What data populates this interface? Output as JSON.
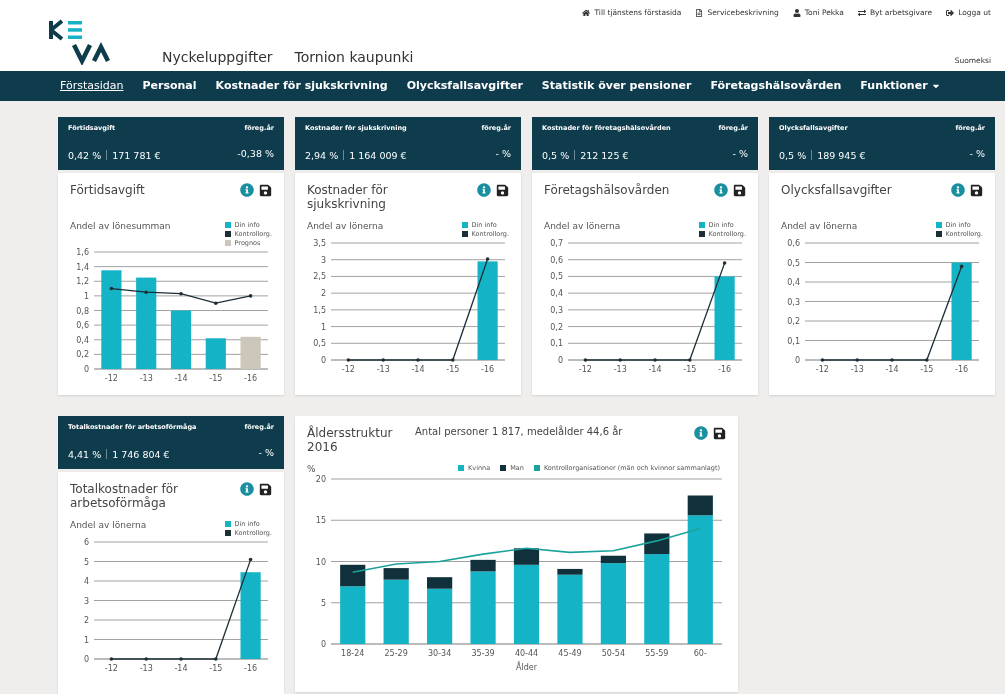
{
  "header": {
    "links": [
      {
        "label": "Till tjänstens förstasida"
      },
      {
        "label": "Servicebeskrivning"
      },
      {
        "label": "Toni Pekka"
      },
      {
        "label": "Byt arbetsgivare"
      },
      {
        "label": "Logga ut"
      }
    ],
    "app_title": "Nyckeluppgifter",
    "organization": "Tornion kaupunki",
    "language": "Suomeksi"
  },
  "nav": [
    {
      "label": "Förstasidan",
      "selected": true,
      "kind": "link"
    },
    {
      "label": "Personal",
      "selected": false,
      "kind": "link"
    },
    {
      "label": "Kostnader för sjukskrivning",
      "selected": false,
      "kind": "link"
    },
    {
      "label": "Olycksfallsavgifter",
      "selected": false,
      "kind": "link"
    },
    {
      "label": "Statistik över pensioner",
      "selected": false,
      "kind": "link"
    },
    {
      "label": "Företagshälsovården",
      "selected": false,
      "kind": "link"
    },
    {
      "label": "Funktioner",
      "selected": false,
      "kind": "dropdown"
    }
  ],
  "widgets": [
    {
      "kind": "small",
      "stat": {
        "title": "Förtidsavgift",
        "prev_label": "föreg.år",
        "percent": "0,42 %",
        "amount": "171 781 €",
        "prev_value": "-0,38 %"
      },
      "card": {
        "title": "Förtidsavgift",
        "chart_data": {
          "type": "bar",
          "grid": true,
          "ylabel": "Andel av lönesumman",
          "categories": [
            "-12",
            "-13",
            "-14",
            "-15",
            "-16"
          ],
          "ylim": [
            0,
            1.6
          ],
          "yticks": [
            {
              "value": 0,
              "label": "0"
            },
            {
              "value": 0.2,
              "label": "0,2"
            },
            {
              "value": 0.4,
              "label": "0,4"
            },
            {
              "value": 0.6,
              "label": "0,6"
            },
            {
              "value": 0.8,
              "label": "0,8"
            },
            {
              "value": 1,
              "label": "1"
            },
            {
              "value": 1.2,
              "label": "1,2"
            },
            {
              "value": 1.4,
              "label": "1,4"
            },
            {
              "value": 1.6,
              "label": "1,6"
            }
          ],
          "series": [
            {
              "name": "Din info",
              "color": "#14b4c6",
              "type": "bar",
              "values": [
                1.35,
                1.25,
                0.8,
                0.42,
                null
              ]
            },
            {
              "name": "Kontrollorg.",
              "color": "#1c2e36",
              "type": "line",
              "values": [
                1.1,
                1.05,
                1.03,
                0.9,
                1.0
              ]
            },
            {
              "name": "Prognos",
              "color": "#cdc6ba",
              "type": "bar",
              "values": [
                null,
                null,
                null,
                null,
                0.44
              ]
            }
          ]
        }
      }
    },
    {
      "kind": "small",
      "stat": {
        "title": "Kostnader för sjukskrivning",
        "prev_label": "föreg.år",
        "percent": "2,94 %",
        "amount": "1 164 009 €",
        "prev_value": "- %"
      },
      "card": {
        "title": "Kostnader för sjukskrivning",
        "chart_data": {
          "type": "bar",
          "grid": true,
          "ylabel": "Andel av lönerna",
          "categories": [
            "-12",
            "-13",
            "-14",
            "-15",
            "-16"
          ],
          "ylim": [
            0,
            3.5
          ],
          "yticks": [
            {
              "value": 0,
              "label": "0"
            },
            {
              "value": 0.5,
              "label": "0,5"
            },
            {
              "value": 1,
              "label": "1"
            },
            {
              "value": 1.5,
              "label": "1,5"
            },
            {
              "value": 2,
              "label": "2"
            },
            {
              "value": 2.5,
              "label": "2,5"
            },
            {
              "value": 3,
              "label": "3"
            },
            {
              "value": 3.5,
              "label": "3,5"
            }
          ],
          "series": [
            {
              "name": "Din info",
              "color": "#14b4c6",
              "type": "bar",
              "values": [
                null,
                null,
                null,
                null,
                2.95
              ]
            },
            {
              "name": "Kontrollorg.",
              "color": "#1c2e36",
              "type": "line",
              "values": [
                0,
                0,
                0,
                0,
                3.02
              ]
            }
          ]
        }
      }
    },
    {
      "kind": "small",
      "stat": {
        "title": "Kostnader för företagshälsovården",
        "prev_label": "föreg.år",
        "percent": "0,5 %",
        "amount": "212 125 €",
        "prev_value": "- %"
      },
      "card": {
        "title": "Företagshälsovården",
        "chart_data": {
          "type": "bar",
          "grid": true,
          "ylabel": "Andel av lönerna",
          "categories": [
            "-12",
            "-13",
            "-14",
            "-15",
            "-16"
          ],
          "ylim": [
            0,
            0.7
          ],
          "yticks": [
            {
              "value": 0,
              "label": "0"
            },
            {
              "value": 0.1,
              "label": "0,1"
            },
            {
              "value": 0.2,
              "label": "0,2"
            },
            {
              "value": 0.3,
              "label": "0,3"
            },
            {
              "value": 0.4,
              "label": "0,4"
            },
            {
              "value": 0.5,
              "label": "0,5"
            },
            {
              "value": 0.6,
              "label": "0,6"
            },
            {
              "value": 0.7,
              "label": "0,7"
            }
          ],
          "series": [
            {
              "name": "Din info",
              "color": "#14b4c6",
              "type": "bar",
              "values": [
                null,
                null,
                null,
                null,
                0.5
              ]
            },
            {
              "name": "Kontrollorg.",
              "color": "#1c2e36",
              "type": "line",
              "values": [
                0,
                0,
                0,
                0,
                0.58
              ]
            }
          ]
        }
      }
    },
    {
      "kind": "small",
      "stat": {
        "title": "Olycksfallsavgifter",
        "prev_label": "föreg.år",
        "percent": "0,5 %",
        "amount": "189 945 €",
        "prev_value": "- %"
      },
      "card": {
        "title": "Olycksfallsavgifter",
        "chart_data": {
          "type": "bar",
          "grid": true,
          "ylabel": "Andel av lönerna",
          "categories": [
            "-12",
            "-13",
            "-14",
            "-15",
            "-16"
          ],
          "ylim": [
            0,
            0.6
          ],
          "yticks": [
            {
              "value": 0,
              "label": "0"
            },
            {
              "value": 0.1,
              "label": "0,1"
            },
            {
              "value": 0.2,
              "label": "0,2"
            },
            {
              "value": 0.3,
              "label": "0,3"
            },
            {
              "value": 0.4,
              "label": "0,4"
            },
            {
              "value": 0.5,
              "label": "0,5"
            },
            {
              "value": 0.6,
              "label": "0,6"
            }
          ],
          "series": [
            {
              "name": "Din info",
              "color": "#14b4c6",
              "type": "bar",
              "values": [
                null,
                null,
                null,
                null,
                0.5
              ]
            },
            {
              "name": "Kontrollorg.",
              "color": "#1c2e36",
              "type": "line",
              "values": [
                0,
                0,
                0,
                0,
                0.48
              ]
            }
          ]
        }
      }
    },
    {
      "kind": "small",
      "stat": {
        "title": "Totalkostnader för arbetsoförmåga",
        "prev_label": "föreg.år",
        "percent": "4,41 %",
        "amount": "1 746 804 €",
        "prev_value": "- %"
      },
      "card": {
        "title": "Totalkostnader för arbetsoförmåga",
        "chart_data": {
          "type": "bar",
          "grid": true,
          "ylabel": "Andel av lönerna",
          "categories": [
            "-12",
            "-13",
            "-14",
            "-15",
            "-16"
          ],
          "ylim": [
            0,
            6
          ],
          "yticks": [
            0,
            1,
            2,
            3,
            4,
            5,
            6
          ],
          "series": [
            {
              "name": "Din info",
              "color": "#14b4c6",
              "type": "bar",
              "values": [
                null,
                null,
                null,
                null,
                4.45
              ]
            },
            {
              "name": "Kontrollorg.",
              "color": "#1c2e36",
              "type": "line",
              "values": [
                0,
                0,
                0,
                0,
                5.1
              ]
            }
          ]
        }
      }
    },
    {
      "kind": "age",
      "card": {
        "title": "Åldersstruktur 2016",
        "subtitle": "Antal personer 1 817, medelålder 44,6 år",
        "chart_data": {
          "type": "bar",
          "grid": true,
          "stacked": true,
          "ylabel": "%",
          "xlabel": "Ålder",
          "categories": [
            "18-24",
            "25-29",
            "30-34",
            "35-39",
            "40-44",
            "45-49",
            "50-54",
            "55-59",
            "60-"
          ],
          "ylim": [
            0,
            20
          ],
          "yticks": [
            0,
            5,
            10,
            15,
            20
          ],
          "series": [
            {
              "name": "Kvinna",
              "color": "#14b4c6",
              "type": "bar",
              "values": [
                7.0,
                7.8,
                6.7,
                8.8,
                9.6,
                8.4,
                9.8,
                10.9,
                15.6
              ]
            },
            {
              "name": "Man",
              "color": "#10303b",
              "type": "bar",
              "values": [
                2.6,
                1.4,
                1.4,
                1.4,
                2.0,
                0.7,
                0.9,
                2.5,
                2.4
              ]
            },
            {
              "name": "Kontrollorganisationer (män och kvinnor sammanlagt)",
              "color": "#1ba39b",
              "type": "line",
              "values": [
                8.7,
                9.7,
                10.0,
                10.9,
                11.6,
                11.1,
                11.3,
                12.5,
                14.0
              ]
            }
          ]
        }
      }
    }
  ]
}
